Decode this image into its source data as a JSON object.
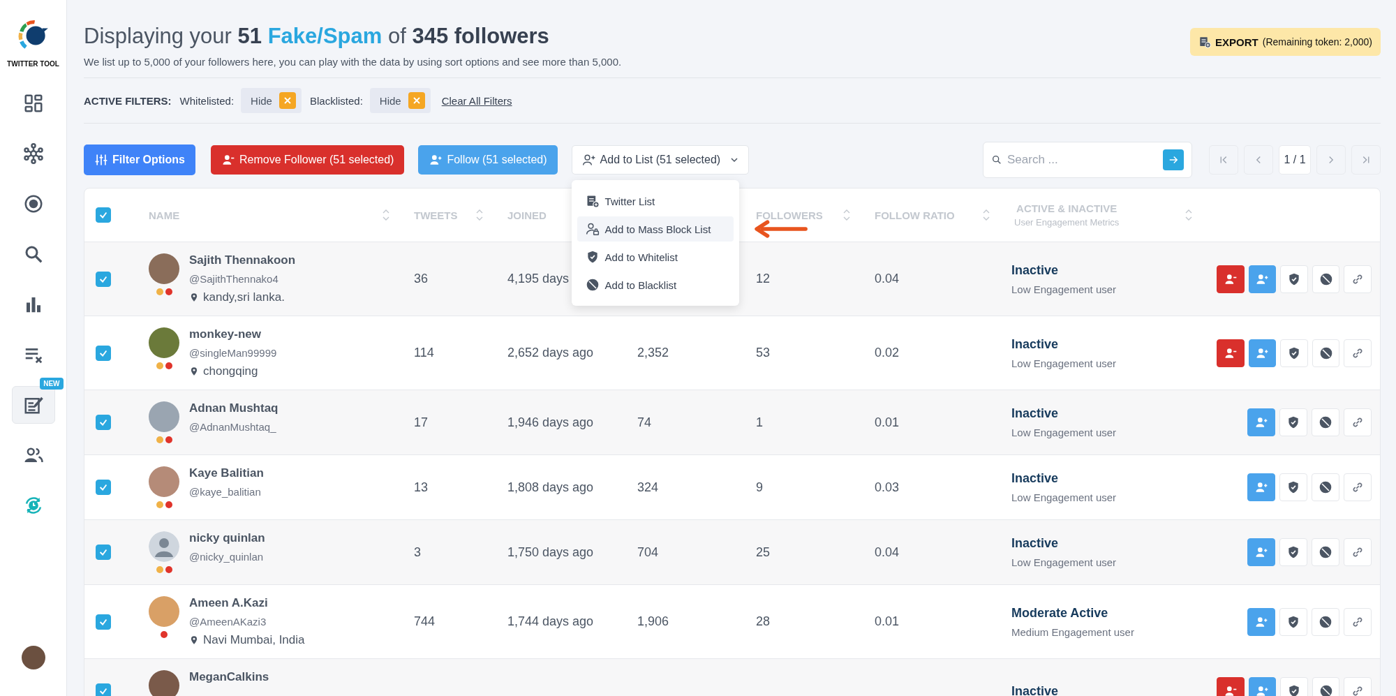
{
  "sidebar": {
    "logo_text": "TWITTER TOOL",
    "items": [
      {
        "kind": "dashboard",
        "selected": false
      },
      {
        "kind": "network",
        "selected": false
      },
      {
        "kind": "target",
        "selected": false
      },
      {
        "kind": "search",
        "selected": false
      },
      {
        "kind": "chart",
        "selected": false
      },
      {
        "kind": "list-x",
        "selected": false
      },
      {
        "kind": "edit",
        "selected": true,
        "badge": "NEW"
      },
      {
        "kind": "users",
        "selected": false
      },
      {
        "kind": "clock-sync",
        "selected": false
      }
    ]
  },
  "header": {
    "title_parts": [
      "Displaying your ",
      "51",
      " Fake/Spam",
      " of ",
      "345 followers"
    ],
    "subtitle": "We list up to 5,000 of your followers here, you can play with the data by using sort options and see more than 5,000.",
    "export": {
      "label": "EXPORT",
      "note": "(Remaining token: 2,000)"
    }
  },
  "filters": {
    "label": "ACTIVE FILTERS:",
    "items": [
      {
        "name": "Whitelisted:",
        "value": "Hide"
      },
      {
        "name": "Blacklisted:",
        "value": "Hide"
      }
    ],
    "clear": "Clear All Filters"
  },
  "toolbar": {
    "buttons": [
      {
        "kind": "filter",
        "label": "Filter Options"
      },
      {
        "kind": "remove",
        "label": "Remove Follower (51 selected)"
      },
      {
        "kind": "follow",
        "label": "Follow (51 selected)"
      },
      {
        "kind": "list",
        "label": "Add to List (51 selected)",
        "expanded": true
      }
    ],
    "menu": [
      {
        "kind": "list",
        "label": "Twitter List",
        "selected": false
      },
      {
        "kind": "block",
        "label": "Add to Mass Block List",
        "selected": true
      },
      {
        "kind": "whitelist",
        "label": "Add to Whitelist",
        "selected": false
      },
      {
        "kind": "blacklist",
        "label": "Add to Blacklist",
        "selected": false
      }
    ],
    "search": {
      "placeholder": "Search ..."
    },
    "page": "1 / 1"
  },
  "table": {
    "all_checked": true,
    "columns": [
      {
        "label": "NAME",
        "sort": true
      },
      {
        "label": "TWEETS",
        "sort": true
      },
      {
        "label": "JOINED",
        "sort": false
      },
      {
        "label": "FOLLOWERS",
        "sort": true
      },
      {
        "label": "FOLLOW RATIO",
        "sort": true
      },
      {
        "label": "ACTIVE & INACTIVE",
        "sub": "User Engagement Metrics",
        "sort": true
      }
    ],
    "rows": [
      {
        "checked": true,
        "name": "Sajith Thennakoon",
        "handle": "@SajithThennako4",
        "location": "kandy,sri lanka.",
        "default_avatar": false,
        "dots": [
          {
            "color": "#f0b247"
          },
          {
            "color": "#e0342b"
          }
        ],
        "tweets": "36",
        "joined": "4,195 days",
        "followers": "12",
        "ratio": "0.04",
        "activity": "Inactive",
        "engagement": "Low Engagement user",
        "actions": [
          {
            "kind": "remove"
          },
          {
            "kind": "follow"
          },
          {
            "kind": "whitelist"
          },
          {
            "kind": "blacklist"
          },
          {
            "kind": "link"
          }
        ]
      },
      {
        "checked": true,
        "name": "monkey-new",
        "handle": "@singleMan99999",
        "location": "chongqing",
        "default_avatar": false,
        "dots": [
          {
            "color": "#f0b247"
          },
          {
            "color": "#e0342b"
          }
        ],
        "tweets": "114",
        "joined": "2,652 days ago",
        "column_4": "2,352",
        "followers": "53",
        "ratio": "0.02",
        "activity": "Inactive",
        "engagement": "Low Engagement user",
        "actions": [
          {
            "kind": "remove"
          },
          {
            "kind": "follow"
          },
          {
            "kind": "whitelist"
          },
          {
            "kind": "blacklist"
          },
          {
            "kind": "link"
          }
        ]
      },
      {
        "checked": true,
        "name": "Adnan Mushtaq",
        "handle": "@AdnanMushtaq_",
        "default_avatar": false,
        "dots": [
          {
            "color": "#f0b247"
          },
          {
            "color": "#e0342b"
          }
        ],
        "tweets": "17",
        "joined": "1,946 days ago",
        "column_4": "74",
        "followers": "1",
        "ratio": "0.01",
        "activity": "Inactive",
        "engagement": "Low Engagement user",
        "actions": [
          {
            "kind": "follow"
          },
          {
            "kind": "whitelist"
          },
          {
            "kind": "blacklist"
          },
          {
            "kind": "link"
          }
        ]
      },
      {
        "checked": true,
        "name": "Kaye Balitian",
        "handle": "@kaye_balitian",
        "default_avatar": false,
        "dots": [
          {
            "color": "#f0b247"
          },
          {
            "color": "#e0342b"
          }
        ],
        "tweets": "13",
        "joined": "1,808 days ago",
        "column_4": "324",
        "followers": "9",
        "ratio": "0.03",
        "activity": "Inactive",
        "engagement": "Low Engagement user",
        "actions": [
          {
            "kind": "follow"
          },
          {
            "kind": "whitelist"
          },
          {
            "kind": "blacklist"
          },
          {
            "kind": "link"
          }
        ]
      },
      {
        "checked": true,
        "name": "nicky quinlan",
        "handle": "@nicky_quinlan",
        "default_avatar": true,
        "dots": [
          {
            "color": "#f0b247"
          },
          {
            "color": "#e0342b"
          }
        ],
        "tweets": "3",
        "joined": "1,750 days ago",
        "column_4": "704",
        "followers": "25",
        "ratio": "0.04",
        "activity": "Inactive",
        "engagement": "Low Engagement user",
        "actions": [
          {
            "kind": "follow"
          },
          {
            "kind": "whitelist"
          },
          {
            "kind": "blacklist"
          },
          {
            "kind": "link"
          }
        ]
      },
      {
        "checked": true,
        "name": "Ameen A.Kazi",
        "handle": "@AmeenAKazi3",
        "location": "Navi Mumbai, India",
        "default_avatar": false,
        "dots": [
          {
            "color": "#e0342b"
          }
        ],
        "tweets": "744",
        "joined": "1,744 days ago",
        "column_4": "1,906",
        "followers": "28",
        "ratio": "0.01",
        "activity": "Moderate Active",
        "engagement": "Medium Engagement user",
        "actions": [
          {
            "kind": "follow"
          },
          {
            "kind": "whitelist"
          },
          {
            "kind": "blacklist"
          },
          {
            "kind": "link"
          }
        ]
      },
      {
        "checked": true,
        "name": "MeganCalkins",
        "default_avatar": false,
        "dots": [],
        "activity": "Inactive",
        "actions": [
          {
            "kind": "remove"
          },
          {
            "kind": "follow"
          },
          {
            "kind": "whitelist"
          },
          {
            "kind": "blacklist"
          },
          {
            "kind": "link"
          }
        ]
      }
    ]
  }
}
